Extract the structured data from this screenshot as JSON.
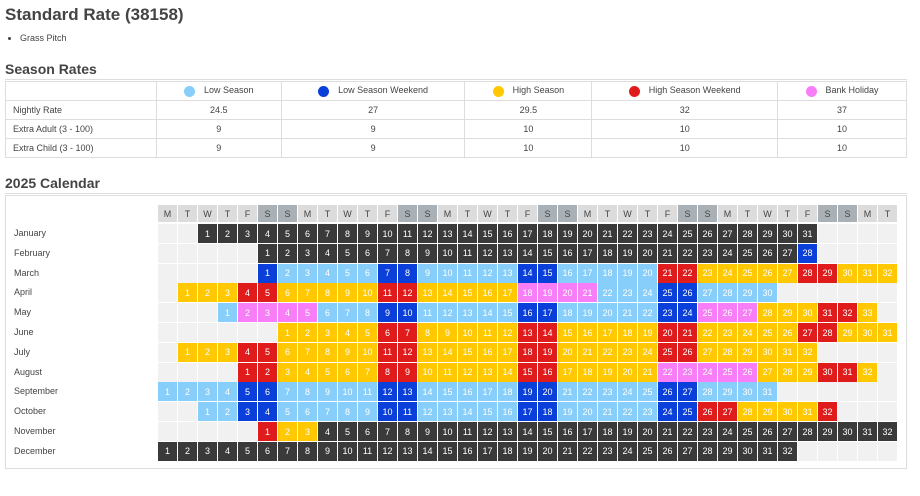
{
  "title": "Standard Rate (38158)",
  "features": [
    "Grass Pitch"
  ],
  "season_rates": {
    "heading": "Season Rates",
    "seasons": [
      {
        "name": "Low Season",
        "color": "#87cefa"
      },
      {
        "name": "Low Season Weekend",
        "color": "#0a3fd9"
      },
      {
        "name": "High Season",
        "color": "#ffc800"
      },
      {
        "name": "High Season Weekend",
        "color": "#e01b1b"
      },
      {
        "name": "Bank Holiday",
        "color": "#f77ef7"
      }
    ],
    "rows": [
      {
        "label": "Nightly Rate",
        "values": [
          "24.5",
          "27",
          "29.5",
          "32",
          "37"
        ]
      },
      {
        "label": "Extra Adult (3 - 100)",
        "values": [
          "9",
          "9",
          "10",
          "10",
          "10"
        ]
      },
      {
        "label": "Extra Child (3 - 100)",
        "values": [
          "9",
          "9",
          "10",
          "10",
          "10"
        ]
      }
    ]
  },
  "calendar": {
    "heading": "2025 Calendar",
    "day_headers": [
      "M",
      "T",
      "W",
      "T",
      "F",
      "S",
      "S",
      "M",
      "T",
      "W",
      "T",
      "F",
      "S",
      "S",
      "M",
      "T",
      "W",
      "T",
      "F",
      "S",
      "S",
      "M",
      "T",
      "W",
      "T",
      "F",
      "S",
      "S",
      "M",
      "T",
      "W",
      "T",
      "F",
      "S",
      "S",
      "M",
      "T"
    ],
    "colors": {
      "closed": "#3a3a3a",
      "low": "#87cefa",
      "low_weekend": "#0a3fd9",
      "high": "#ffc800",
      "high_weekend": "#e01b1b",
      "bank_holiday": "#f77ef7",
      "header_weekday": "#dcdcdc",
      "header_weekend": "#a9b1b6"
    },
    "months": [
      {
        "name": "January",
        "offset": 2,
        "days": "CCCCCCCCCCCCCCCCCCCCCCCCCCCCCCC"
      },
      {
        "name": "February",
        "offset": 5,
        "days": "CCCCCCCCCCCCCCCCCCCCCCCCCCCD"
      },
      {
        "name": "March",
        "offset": 5,
        "days": "DLLLLLDDLLLLLDDLLLLLWWHHHHHWWHHHH"
      },
      {
        "name": "April",
        "offset": 1,
        "days": "HHHWWHHHHHWWHHHHHBBBBLLLDDLLLL"
      },
      {
        "name": "May",
        "offset": 3,
        "days": "LBBBBLLLDDLLLLLDDLLLLLDDBBBHHHWWH"
      },
      {
        "name": "June",
        "offset": 6,
        "days": "HHHHHWWHHHHHWWHHHHHWWHHHHHWWHHH"
      },
      {
        "name": "July",
        "offset": 1,
        "days": "HHHWWHHHHHWWHHHHHWWHHHHHWWHHHHHH"
      },
      {
        "name": "August",
        "offset": 4,
        "days": "WWHHHHHWWHHHHHWWHHHHHBBBBBHHHWWH"
      },
      {
        "name": "September",
        "offset": 0,
        "days": "LLLLDDLLLLLDDLLLLLDDLLLLLDDLLLL"
      },
      {
        "name": "October",
        "offset": 2,
        "days": "LLDDLLLLLDDLLLLLDDLLLLLDDWWHHHHW"
      },
      {
        "name": "November",
        "offset": 5,
        "days": "WHHCCCCCCCCCCCCCCCCCCCCCCCCCCCCC"
      },
      {
        "name": "December",
        "offset": 0,
        "days": "CCCCCCCCCCCCCCCCCCCCCCCCCCCCCCCC"
      }
    ]
  }
}
